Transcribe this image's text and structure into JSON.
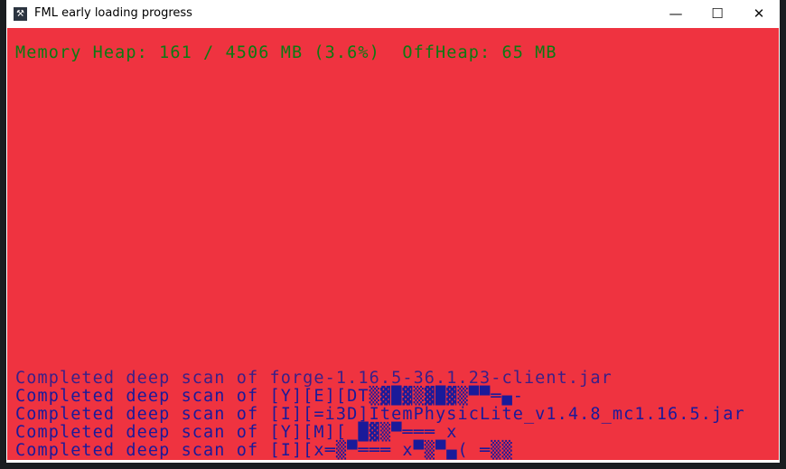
{
  "window": {
    "title": "FML early loading progress",
    "controls": {
      "minimize": "—",
      "maximize": "☐",
      "close": "✕"
    }
  },
  "memory_line": "Memory Heap: 161 / 4506 MB (3.6%)  OffHeap: 65 MB",
  "log_lines": [
    "Completed deep scan of forge-1.16.5-36.1.23-client.jar",
    "Completed deep scan of [Y][E][DT▒▓█▓▒▓█▓▒▀▀═▄-",
    "Completed deep scan of [I][=i3D]ItemPhysicLite_v1.4.8_mc1.16.5.jar",
    "Completed deep scan of [Y][M][ █▓▒▀═══ x",
    "Completed deep scan of [I][x═▒▀═══ x▀▒▀▄( ═▒▒"
  ]
}
